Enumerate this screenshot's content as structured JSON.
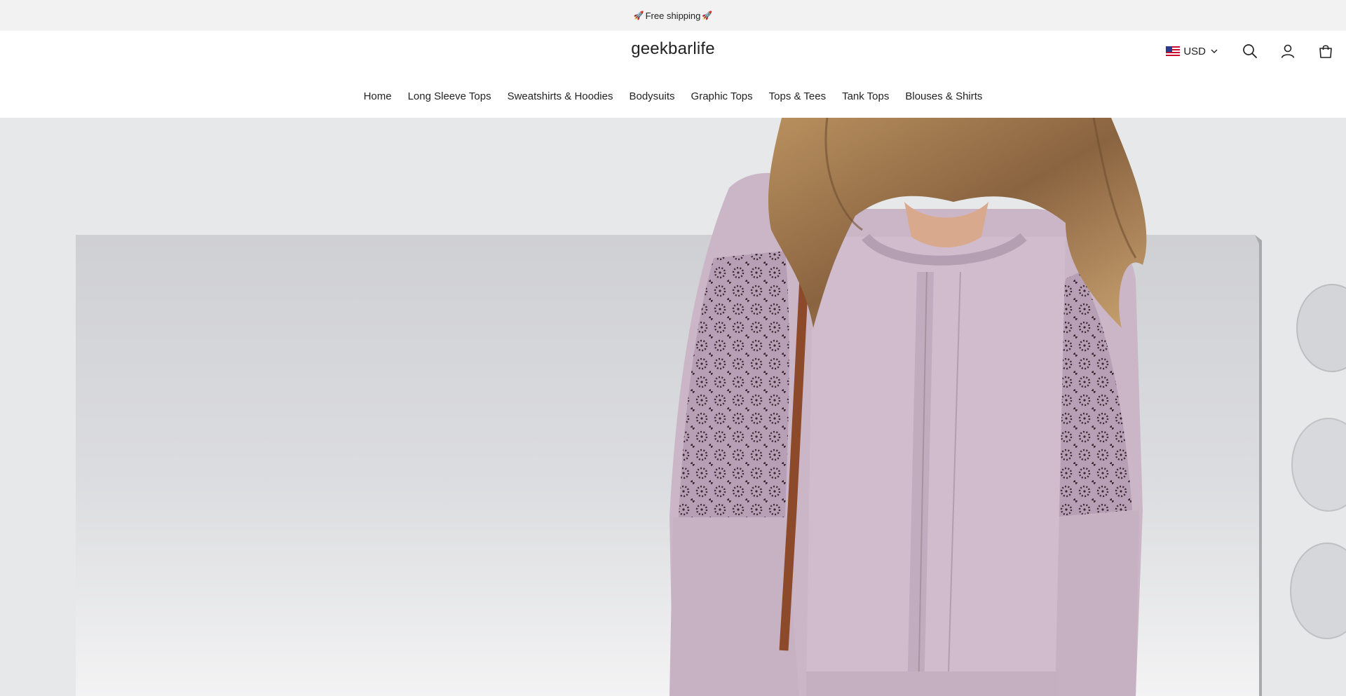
{
  "announcement": {
    "text": "Free shipping",
    "left_emoji": "🚀",
    "right_emoji": "🚀"
  },
  "header": {
    "logo": "geekbarlife",
    "currency": {
      "flag": "us-flag-icon",
      "label": "USD"
    },
    "icons": [
      "search-icon",
      "account-icon",
      "cart-icon"
    ]
  },
  "nav": {
    "items": [
      {
        "label": "Home"
      },
      {
        "label": "Long Sleeve Tops"
      },
      {
        "label": "Sweatshirts & Hoodies"
      },
      {
        "label": "Bodysuits"
      },
      {
        "label": "Graphic Tops"
      },
      {
        "label": "Tops & Tees"
      },
      {
        "label": "Tank Tops"
      },
      {
        "label": "Blouses & Shirts"
      }
    ]
  },
  "hero": {
    "image": "woman-in-lilac-lace-sleeve-sweatshirt"
  },
  "colors": {
    "announcement_bg": "#f2f2f2",
    "text": "#222222",
    "sweatshirt": "#cbb6c8"
  }
}
